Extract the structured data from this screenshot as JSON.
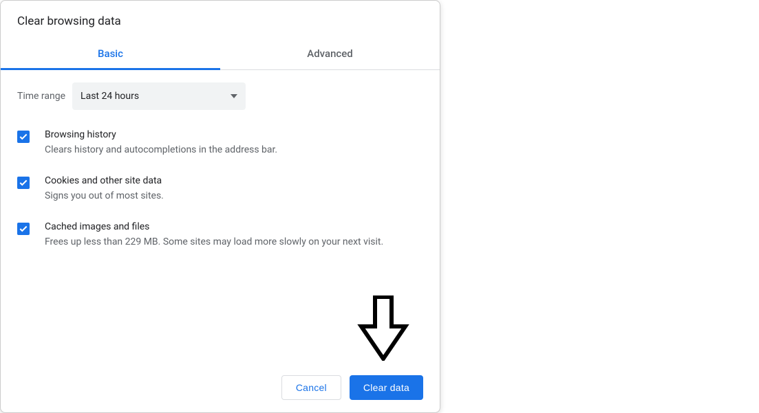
{
  "dialog": {
    "title": "Clear browsing data"
  },
  "tabs": {
    "basic": "Basic",
    "advanced": "Advanced"
  },
  "timeRange": {
    "label": "Time range",
    "selected": "Last 24 hours"
  },
  "options": [
    {
      "title": "Browsing history",
      "description": "Clears history and autocompletions in the address bar.",
      "checked": true
    },
    {
      "title": "Cookies and other site data",
      "description": "Signs you out of most sites.",
      "checked": true
    },
    {
      "title": "Cached images and files",
      "description": "Frees up less than 229 MB. Some sites may load more slowly on your next visit.",
      "checked": true
    }
  ],
  "actions": {
    "cancel": "Cancel",
    "clear": "Clear data"
  }
}
